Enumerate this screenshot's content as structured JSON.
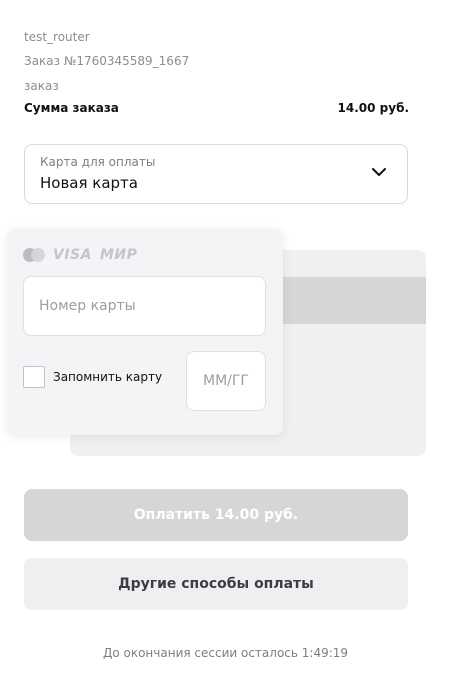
{
  "order": {
    "merchant": "test_router",
    "number": "Заказ №1760345589_1667",
    "description": "заказ",
    "sum_label": "Сумма заказа",
    "sum_value": "14.00 руб."
  },
  "payment_select": {
    "label": "Карта для оплаты",
    "value": "Новая карта",
    "icon": "chevron-down-icon"
  },
  "card_form": {
    "brands": [
      "mastercard-logo",
      "VISA",
      "МИР"
    ],
    "card_number_placeholder": "Номер карты",
    "remember_label": "Запомнить карту",
    "remember_checked": false,
    "expiry_placeholder": "ММ/ГГ"
  },
  "actions": {
    "pay_label": "Оплатить 14.00 руб.",
    "other_label": "Другие способы оплаты"
  },
  "session": {
    "text": "До окончания сессии осталось 1:49:19"
  },
  "colors": {
    "pay_button_disabled": "#d6d6d8",
    "secondary_button": "#efeff1",
    "card_front": "#f4f4f6",
    "card_back": "#f0f0f2"
  }
}
